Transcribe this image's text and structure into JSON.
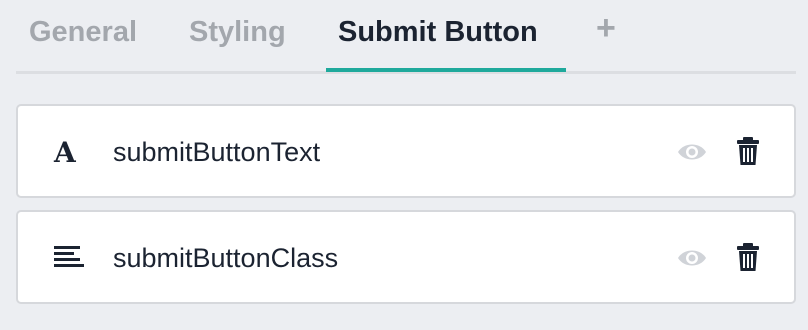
{
  "tabs": [
    {
      "label": "General",
      "active": false
    },
    {
      "label": "Styling",
      "active": false
    },
    {
      "label": "Submit Button",
      "active": true
    },
    {
      "label": "+",
      "active": false
    }
  ],
  "fields": [
    {
      "icon": "text-type-icon",
      "name": "submitButtonText"
    },
    {
      "icon": "align-left-icon",
      "name": "submitButtonClass"
    }
  ],
  "colors": {
    "background": "#eceef2",
    "accent": "#1fa99c",
    "active_text": "#1b2331",
    "inactive_text": "#a3a7ad",
    "eye_icon": "#d0d3d8"
  }
}
